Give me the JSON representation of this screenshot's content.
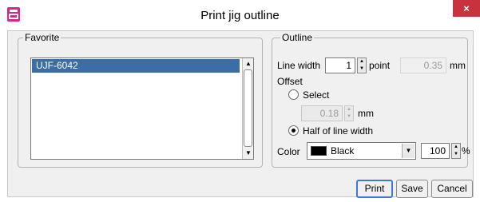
{
  "window": {
    "title": "Print jig outline",
    "app_icon": "printer-app-icon",
    "close_glyph": "×"
  },
  "favorite": {
    "group_label": "Favorite",
    "items": [
      "UJF-6042"
    ],
    "selected_index": 0
  },
  "outline": {
    "group_label": "Outline",
    "line_width": {
      "label": "Line width",
      "value": "1",
      "unit": "point",
      "mm_value": "0.35",
      "mm_unit": "mm"
    },
    "offset": {
      "label": "Offset",
      "select_label": "Select",
      "select_value": "0.18",
      "select_unit": "mm",
      "half_label": "Half of line width",
      "selected_option": "half"
    },
    "color": {
      "label": "Color",
      "selected": "Black",
      "swatch": "#000000",
      "percent_value": "100",
      "percent_unit": "%"
    }
  },
  "buttons": {
    "print": "Print",
    "save": "Save",
    "cancel": "Cancel"
  },
  "colors": {
    "selection": "#3a6ea5",
    "close_button": "#c7323c",
    "default_button_border": "#3b7bd6"
  }
}
